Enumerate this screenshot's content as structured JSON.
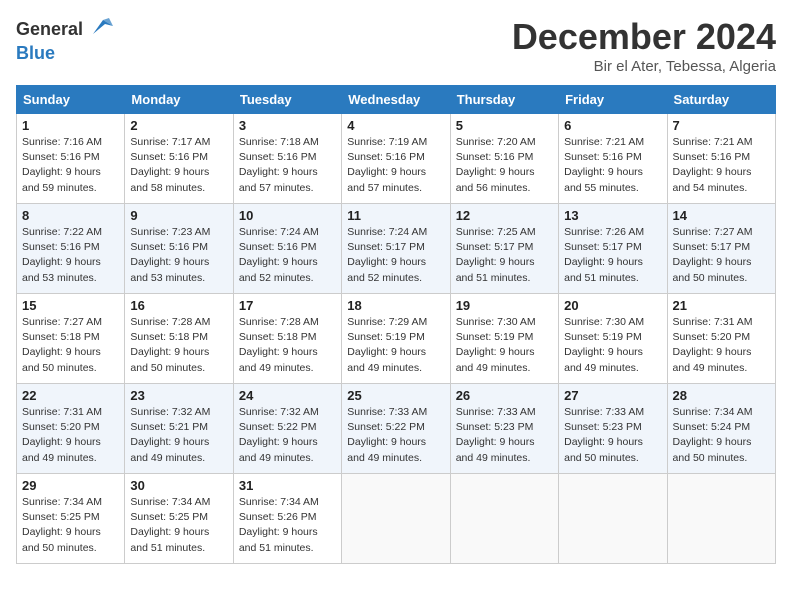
{
  "header": {
    "logo_general": "General",
    "logo_blue": "Blue",
    "month": "December 2024",
    "location": "Bir el Ater, Tebessa, Algeria"
  },
  "columns": [
    "Sunday",
    "Monday",
    "Tuesday",
    "Wednesday",
    "Thursday",
    "Friday",
    "Saturday"
  ],
  "weeks": [
    [
      {
        "day": "1",
        "sunrise": "7:16 AM",
        "sunset": "5:16 PM",
        "daylight": "9 hours and 59 minutes."
      },
      {
        "day": "2",
        "sunrise": "7:17 AM",
        "sunset": "5:16 PM",
        "daylight": "9 hours and 58 minutes."
      },
      {
        "day": "3",
        "sunrise": "7:18 AM",
        "sunset": "5:16 PM",
        "daylight": "9 hours and 57 minutes."
      },
      {
        "day": "4",
        "sunrise": "7:19 AM",
        "sunset": "5:16 PM",
        "daylight": "9 hours and 57 minutes."
      },
      {
        "day": "5",
        "sunrise": "7:20 AM",
        "sunset": "5:16 PM",
        "daylight": "9 hours and 56 minutes."
      },
      {
        "day": "6",
        "sunrise": "7:21 AM",
        "sunset": "5:16 PM",
        "daylight": "9 hours and 55 minutes."
      },
      {
        "day": "7",
        "sunrise": "7:21 AM",
        "sunset": "5:16 PM",
        "daylight": "9 hours and 54 minutes."
      }
    ],
    [
      {
        "day": "8",
        "sunrise": "7:22 AM",
        "sunset": "5:16 PM",
        "daylight": "9 hours and 53 minutes."
      },
      {
        "day": "9",
        "sunrise": "7:23 AM",
        "sunset": "5:16 PM",
        "daylight": "9 hours and 53 minutes."
      },
      {
        "day": "10",
        "sunrise": "7:24 AM",
        "sunset": "5:16 PM",
        "daylight": "9 hours and 52 minutes."
      },
      {
        "day": "11",
        "sunrise": "7:24 AM",
        "sunset": "5:17 PM",
        "daylight": "9 hours and 52 minutes."
      },
      {
        "day": "12",
        "sunrise": "7:25 AM",
        "sunset": "5:17 PM",
        "daylight": "9 hours and 51 minutes."
      },
      {
        "day": "13",
        "sunrise": "7:26 AM",
        "sunset": "5:17 PM",
        "daylight": "9 hours and 51 minutes."
      },
      {
        "day": "14",
        "sunrise": "7:27 AM",
        "sunset": "5:17 PM",
        "daylight": "9 hours and 50 minutes."
      }
    ],
    [
      {
        "day": "15",
        "sunrise": "7:27 AM",
        "sunset": "5:18 PM",
        "daylight": "9 hours and 50 minutes."
      },
      {
        "day": "16",
        "sunrise": "7:28 AM",
        "sunset": "5:18 PM",
        "daylight": "9 hours and 50 minutes."
      },
      {
        "day": "17",
        "sunrise": "7:28 AM",
        "sunset": "5:18 PM",
        "daylight": "9 hours and 49 minutes."
      },
      {
        "day": "18",
        "sunrise": "7:29 AM",
        "sunset": "5:19 PM",
        "daylight": "9 hours and 49 minutes."
      },
      {
        "day": "19",
        "sunrise": "7:30 AM",
        "sunset": "5:19 PM",
        "daylight": "9 hours and 49 minutes."
      },
      {
        "day": "20",
        "sunrise": "7:30 AM",
        "sunset": "5:19 PM",
        "daylight": "9 hours and 49 minutes."
      },
      {
        "day": "21",
        "sunrise": "7:31 AM",
        "sunset": "5:20 PM",
        "daylight": "9 hours and 49 minutes."
      }
    ],
    [
      {
        "day": "22",
        "sunrise": "7:31 AM",
        "sunset": "5:20 PM",
        "daylight": "9 hours and 49 minutes."
      },
      {
        "day": "23",
        "sunrise": "7:32 AM",
        "sunset": "5:21 PM",
        "daylight": "9 hours and 49 minutes."
      },
      {
        "day": "24",
        "sunrise": "7:32 AM",
        "sunset": "5:22 PM",
        "daylight": "9 hours and 49 minutes."
      },
      {
        "day": "25",
        "sunrise": "7:33 AM",
        "sunset": "5:22 PM",
        "daylight": "9 hours and 49 minutes."
      },
      {
        "day": "26",
        "sunrise": "7:33 AM",
        "sunset": "5:23 PM",
        "daylight": "9 hours and 49 minutes."
      },
      {
        "day": "27",
        "sunrise": "7:33 AM",
        "sunset": "5:23 PM",
        "daylight": "9 hours and 50 minutes."
      },
      {
        "day": "28",
        "sunrise": "7:34 AM",
        "sunset": "5:24 PM",
        "daylight": "9 hours and 50 minutes."
      }
    ],
    [
      {
        "day": "29",
        "sunrise": "7:34 AM",
        "sunset": "5:25 PM",
        "daylight": "9 hours and 50 minutes."
      },
      {
        "day": "30",
        "sunrise": "7:34 AM",
        "sunset": "5:25 PM",
        "daylight": "9 hours and 51 minutes."
      },
      {
        "day": "31",
        "sunrise": "7:34 AM",
        "sunset": "5:26 PM",
        "daylight": "9 hours and 51 minutes."
      },
      null,
      null,
      null,
      null
    ]
  ]
}
